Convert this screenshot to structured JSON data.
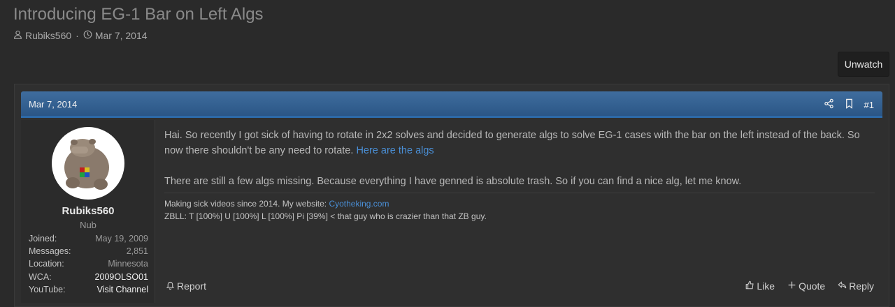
{
  "thread": {
    "title": "Introducing EG-1 Bar on Left Algs",
    "author": "Rubiks560",
    "separator": "·",
    "date": "Mar 7, 2014"
  },
  "watch_button": "Unwatch",
  "post": {
    "date": "Mar 7, 2014",
    "number": "#1",
    "paragraph1": "Hai. So recently I got sick of having to rotate in 2x2 solves and decided to generate algs to solve EG-1 cases with the bar on the left instead of the back. So now there shouldn't be any need to rotate. ",
    "link_text": "Here are the algs",
    "paragraph2": "There are still a few algs missing. Because everything I have genned is absolute trash. So if you can find a nice alg, let me know.",
    "signature": {
      "line1_text": "Making sick videos since 2014. My website: ",
      "line1_link": "Cyotheking.com",
      "line2": "ZBLL: T [100%] U [100%] L [100%] Pi [39%] < that guy who is crazier than that ZB guy."
    }
  },
  "user": {
    "name": "Rubiks560",
    "title": "Nub",
    "stats": [
      {
        "key": "Joined:",
        "value": "May 19, 2009"
      },
      {
        "key": "Messages:",
        "value": "2,851"
      },
      {
        "key": "Location:",
        "value": "Minnesota"
      },
      {
        "key": "WCA:",
        "value": "2009OLSO01"
      },
      {
        "key": "YouTube:",
        "value": "Visit Channel"
      }
    ]
  },
  "actions": {
    "report": "Report",
    "like": "Like",
    "quote": "Quote",
    "reply": "Reply"
  },
  "icons": [
    "user-icon",
    "clock-icon",
    "share-icon",
    "bookmark-icon",
    "bell-icon",
    "thumbs-up-icon",
    "plus-icon",
    "reply-icon"
  ],
  "colors": {
    "background": "#2a2a2a",
    "header_blue": "#2b5686",
    "link": "#4a8fd6"
  }
}
